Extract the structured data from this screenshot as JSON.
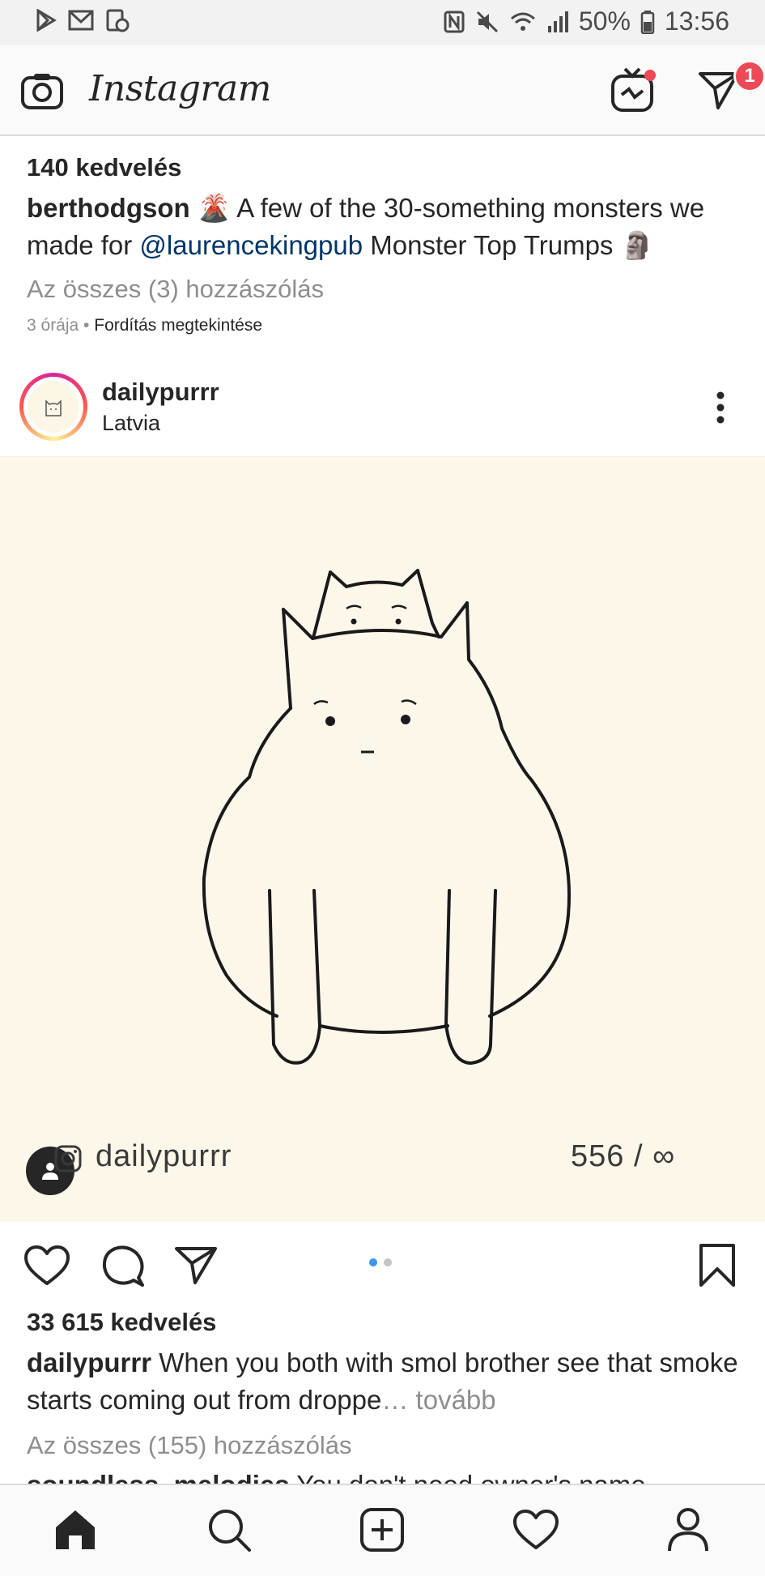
{
  "status_bar": {
    "left_icons": [
      "play-store-icon",
      "gmail-icon",
      "screen-record-icon"
    ],
    "right_icons": [
      "nfc-icon",
      "mute-icon",
      "wifi-icon",
      "signal-icon",
      "battery-icon"
    ],
    "battery": "50%",
    "time": "13:56"
  },
  "header": {
    "logo": "Instagram",
    "icons": [
      "camera-icon",
      "igtv-icon",
      "direct-icon"
    ],
    "direct_badge": "1"
  },
  "previous_post": {
    "likes": "140 kedvelés",
    "username": "berthodgson",
    "caption_emoji_1": "🌋",
    "caption_part1": " A few of the 30-something monsters we made for ",
    "mention": "@laurencekingpub",
    "caption_part2": " Monster Top Trumps ",
    "caption_emoji_2": "🗿",
    "view_comments": "Az összes (3) hozzászólás",
    "time_ago": "3 órája",
    "separator": " • ",
    "translate": "Fordítás megtekintése"
  },
  "post": {
    "username": "dailypurrr",
    "location": "Latvia",
    "image": {
      "watermark_handle": "dailypurrr",
      "watermark_counter": "556 / ∞"
    },
    "page_count": 2,
    "active_page": 0,
    "likes": "33 615 kedvelés",
    "caption_username": "dailypurrr",
    "caption_text": " When you both with smol brother see that smoke starts coming out from droppe",
    "ellipsis": "…",
    "more": " tovább",
    "view_comments": "Az összes (155) hozzászólás",
    "next_comment_user": "soundless_melodies",
    "next_comment_text": " You don't need owner's name"
  },
  "tab_bar": {
    "items": [
      "home-icon",
      "search-icon",
      "new-post-icon",
      "activity-icon",
      "profile-icon"
    ],
    "active": "home-icon"
  },
  "colors": {
    "accent_blue": "#3897f0",
    "badge_red": "#ed4956",
    "link": "#003569",
    "muted": "#8e8e8e",
    "image_bg": "#fdf7ea"
  }
}
